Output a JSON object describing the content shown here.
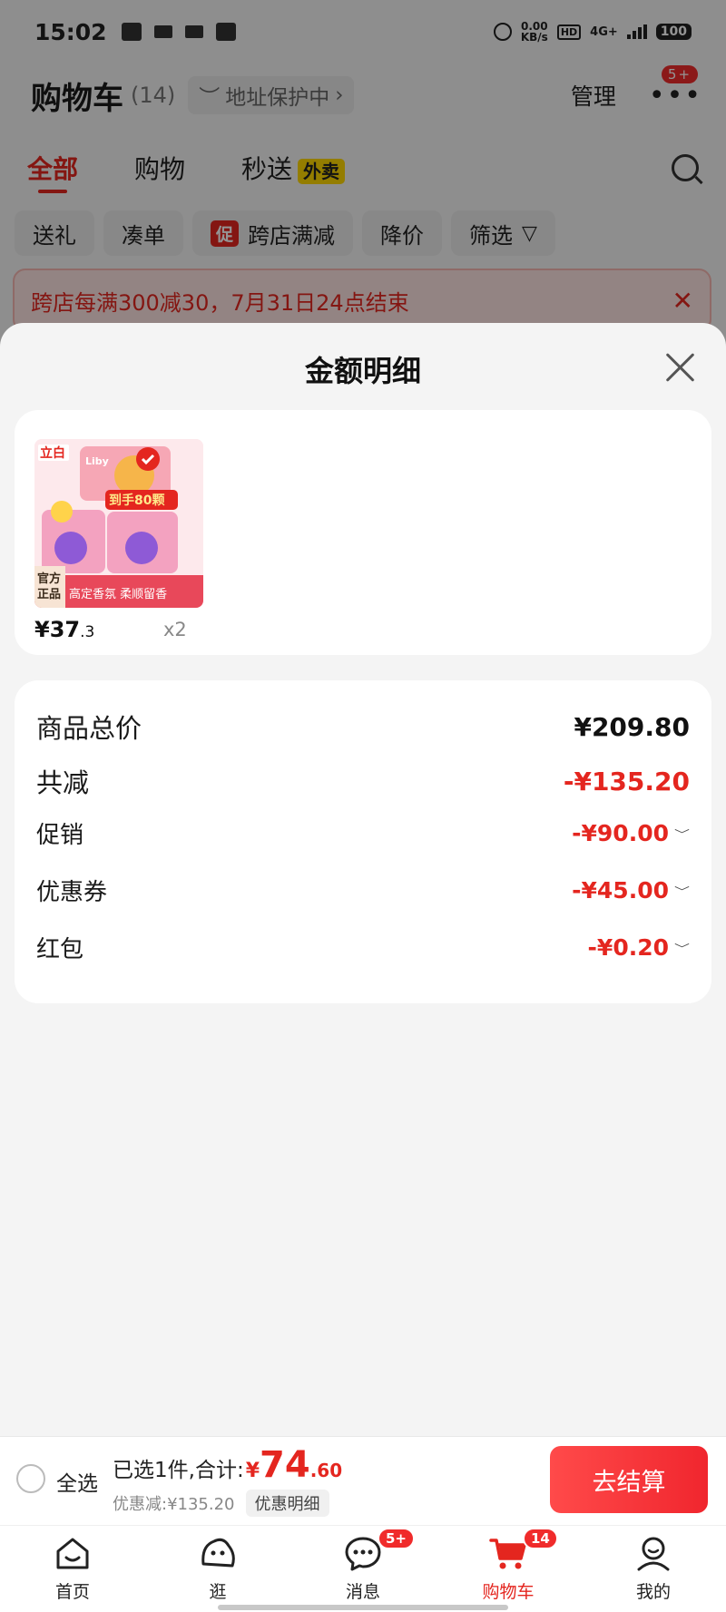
{
  "status_bar": {
    "time": "15:02",
    "net_speed_value": "0.00",
    "net_speed_unit": "KB/s",
    "hd_label": "HD",
    "signal_label": "4G+",
    "battery": "100"
  },
  "cart_header": {
    "title": "购物车",
    "count": "(14)",
    "address_protect": "地址保护中",
    "manage_label": "管理",
    "more_badge": "5+"
  },
  "tabs": [
    {
      "label": "全部",
      "active": true
    },
    {
      "label": "购物",
      "active": false
    },
    {
      "label": "秒送",
      "active": false,
      "tag": "外卖"
    }
  ],
  "filters": [
    {
      "label": "送礼"
    },
    {
      "label": "凑单"
    },
    {
      "label": "跨店满减",
      "mark": "促"
    },
    {
      "label": "降价"
    },
    {
      "label": "筛选"
    }
  ],
  "notice": {
    "text": "跨店每满300减30，7月31日24点结束"
  },
  "sheet": {
    "title": "金额明细",
    "product": {
      "price_prefix": "¥37",
      "price_decimal": ".3",
      "quantity": "x2",
      "image_text": {
        "brand": "立白",
        "logo": "Liby",
        "promo": "到手80颗",
        "official_1": "官方",
        "official_2": "正品",
        "tagline": "高定香氛 柔顺留香"
      }
    },
    "summary": {
      "rows": [
        {
          "label": "商品总价",
          "value": "¥209.80"
        },
        {
          "label": "共减",
          "value": "-¥135.20"
        },
        {
          "label": "促销",
          "value": "-¥90.00"
        },
        {
          "label": "优惠券",
          "value": "-¥45.00"
        },
        {
          "label": "红包",
          "value": "-¥0.20"
        }
      ]
    }
  },
  "checkout": {
    "select_all": "全选",
    "selected_prefix": "已选1件,合计:",
    "currency": "¥",
    "total_int": "74",
    "total_dec": ".60",
    "discount_text": "优惠减:¥135.20",
    "detail_label": "优惠明细",
    "checkout_label": "去结算"
  },
  "bottom_nav": {
    "items": [
      {
        "label": "首页",
        "icon": "home-icon"
      },
      {
        "label": "逛",
        "icon": "discover-icon"
      },
      {
        "label": "消息",
        "icon": "message-icon",
        "badge": "5+"
      },
      {
        "label": "购物车",
        "icon": "cart-icon",
        "badge": "14",
        "active": true
      },
      {
        "label": "我的",
        "icon": "profile-icon"
      }
    ]
  },
  "colors": {
    "accent": "#e4261f",
    "badge": "#f02b2b",
    "tag_yellow": "#ffd800"
  }
}
